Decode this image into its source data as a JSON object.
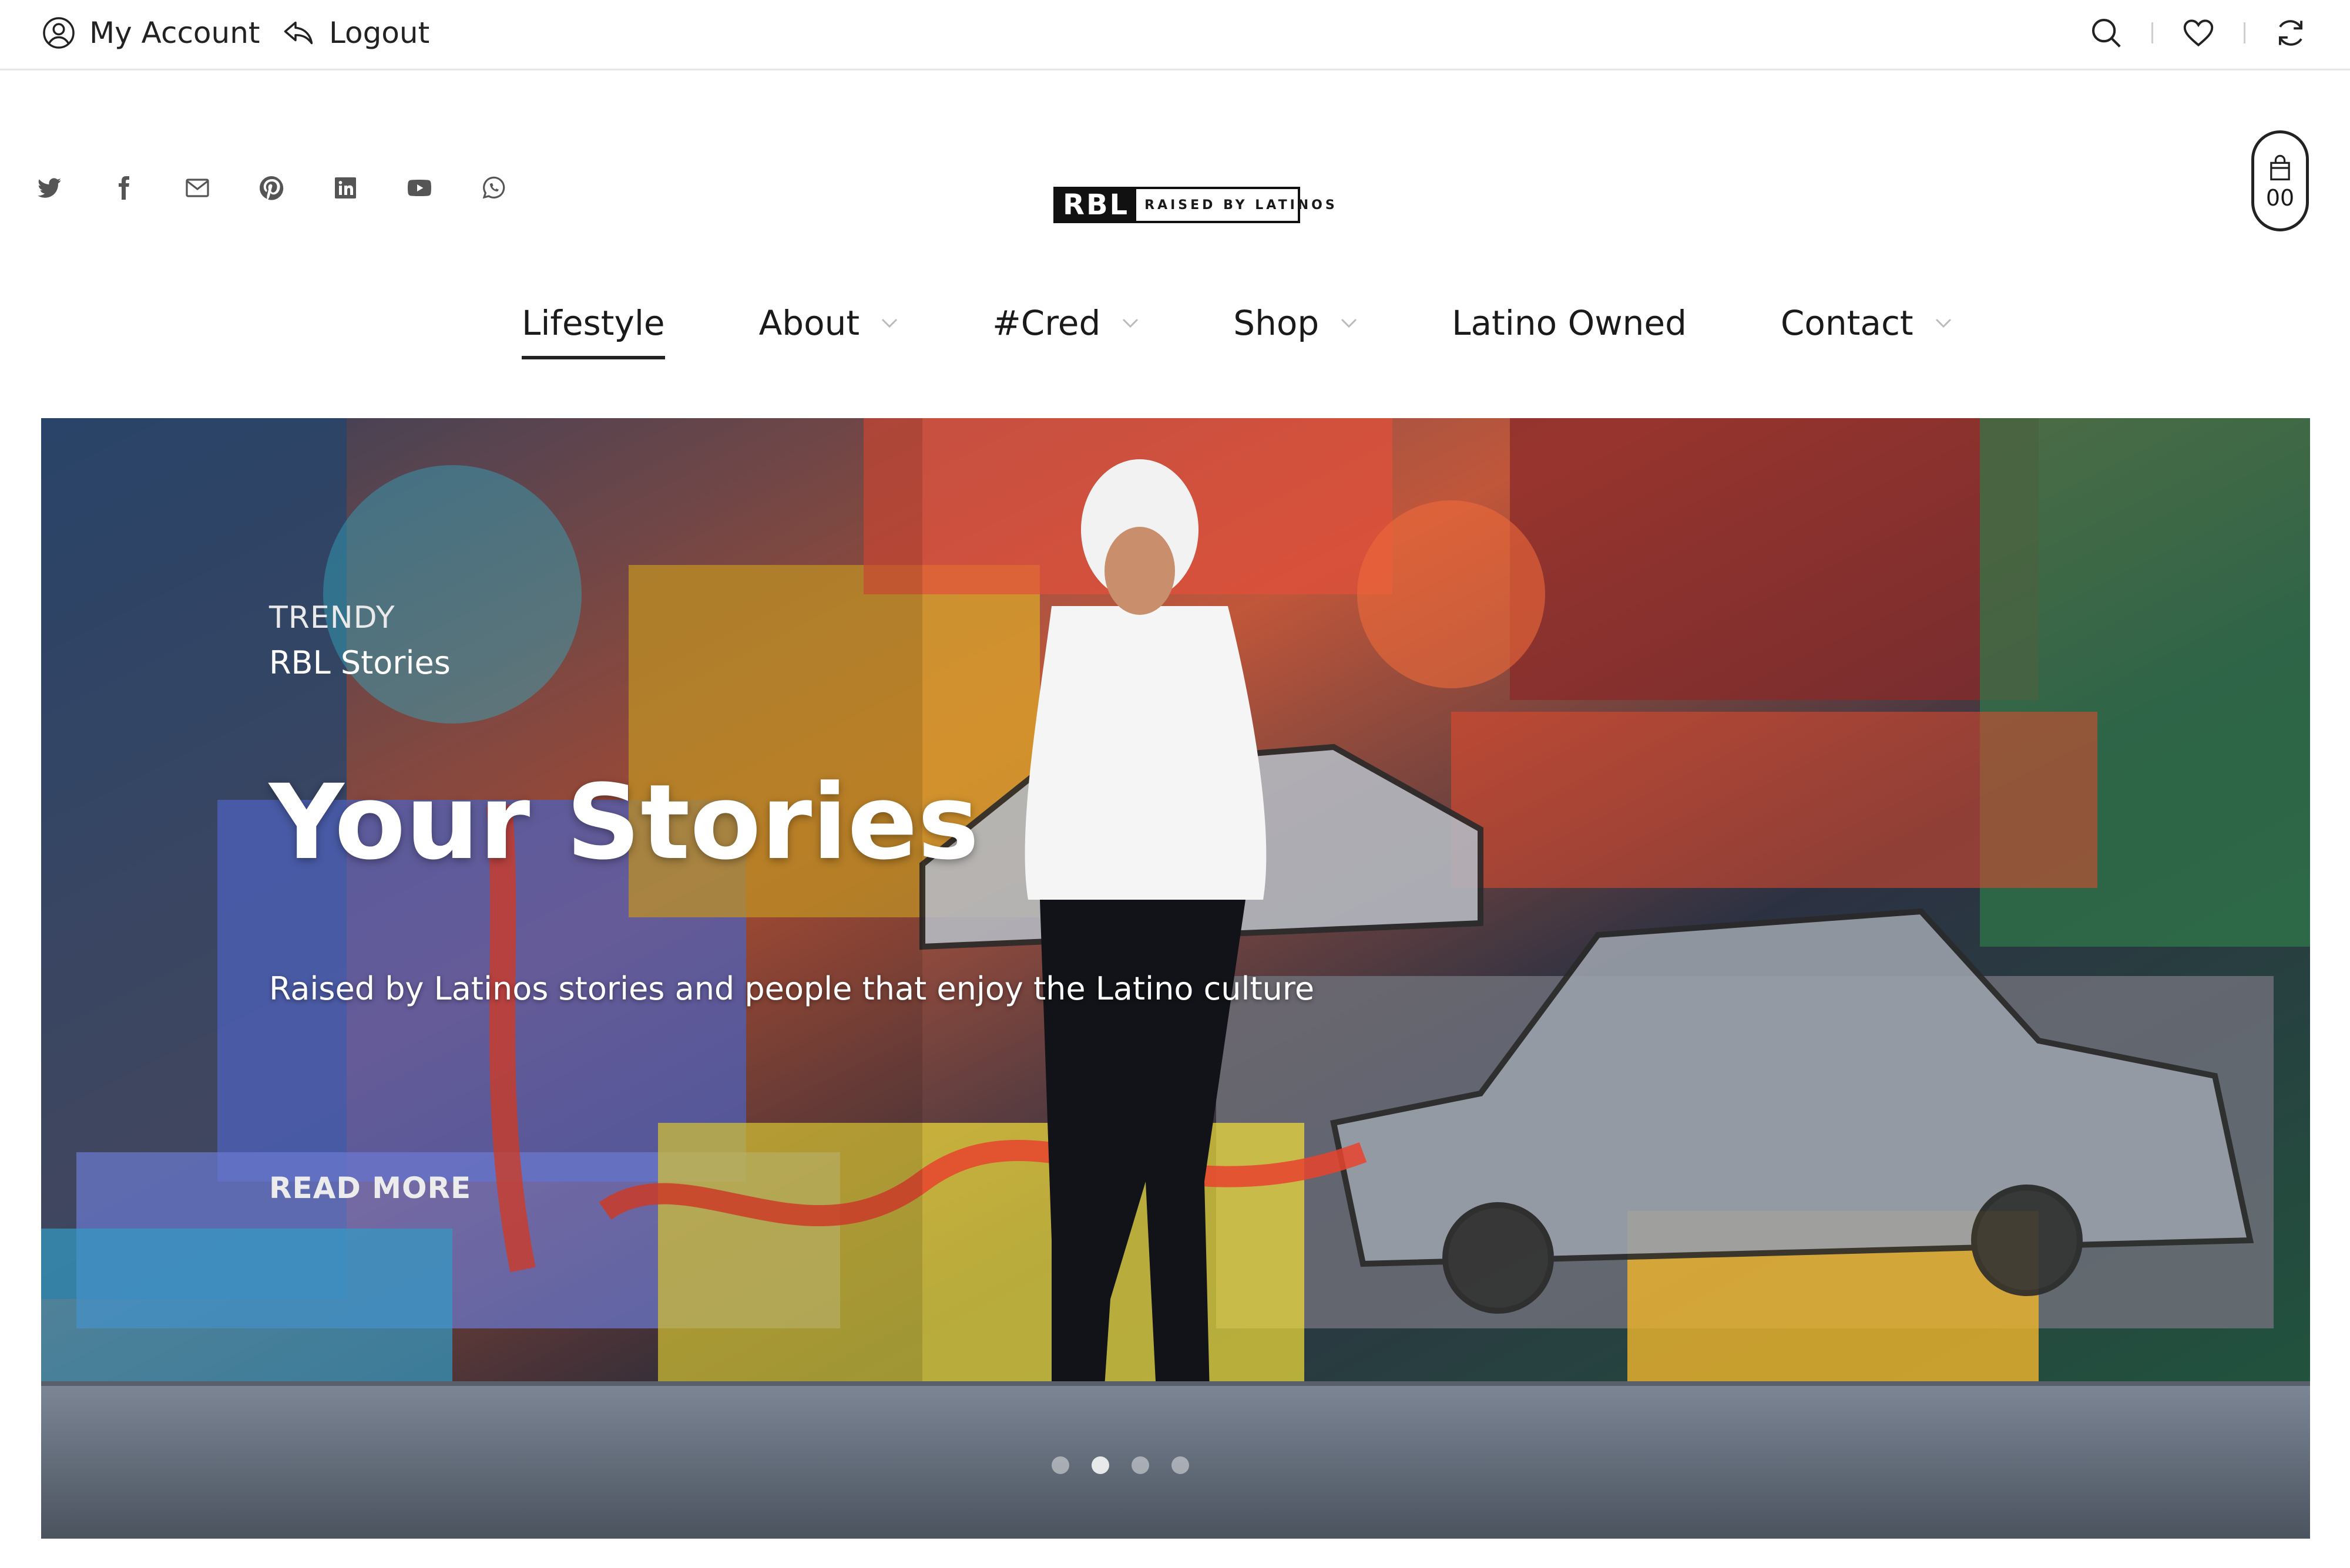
{
  "topbar": {
    "account_label": "My Account",
    "logout_label": "Logout"
  },
  "social_icons": [
    "twitter-icon",
    "facebook-icon",
    "email-icon",
    "pinterest-icon",
    "linkedin-icon",
    "youtube-icon",
    "whatsapp-icon"
  ],
  "logo": {
    "mark": "RBL",
    "tagline": "RAISED BY LATINOS"
  },
  "cart": {
    "count": "00"
  },
  "nav": {
    "items": [
      {
        "label": "Lifestyle",
        "active": true
      },
      {
        "label": "About",
        "dropdown": true
      },
      {
        "label": "#Cred",
        "dropdown": true
      },
      {
        "label": "Shop",
        "dropdown": true
      },
      {
        "label": "Latino Owned"
      },
      {
        "label": "Contact",
        "dropdown": true
      }
    ]
  },
  "hero": {
    "kicker": "TRENDY",
    "category": "RBL Stories",
    "title": "Your Stories",
    "description": "Raised by Latinos stories and people that enjoy the Latino culture",
    "cta": "READ MORE",
    "slides": 4,
    "active_slide": 2
  },
  "colors": {
    "text": "#1a1a1a",
    "border": "#e6e6e6",
    "hero_text": "#ffffff"
  }
}
